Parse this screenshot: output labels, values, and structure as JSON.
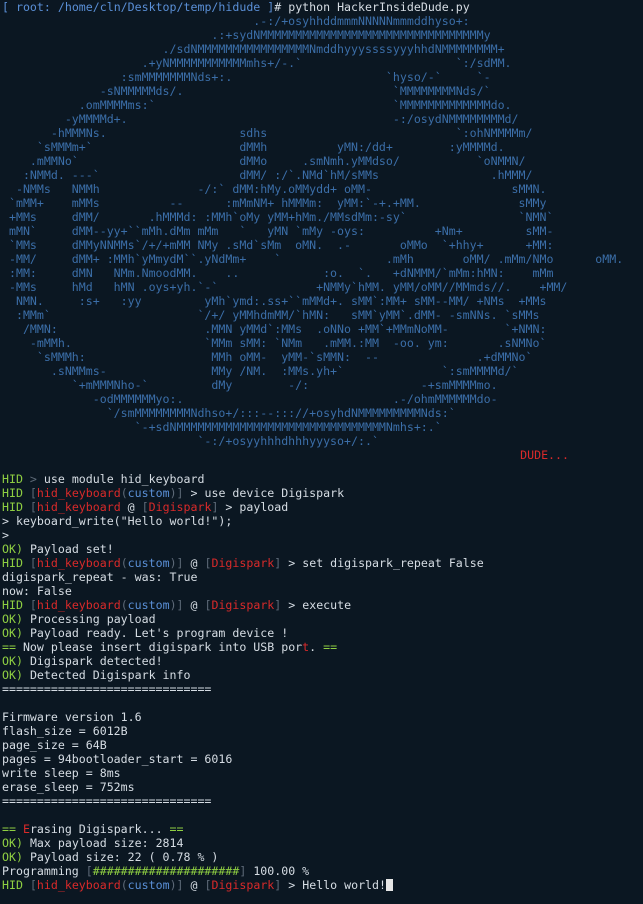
{
  "prompt": {
    "bracket_open": "[ ",
    "user": "root",
    "sep": ": ",
    "path": "/home/cln/Desktop/temp/hidude",
    "bracket_close": " ]",
    "hash": "# ",
    "command": "python HackerInsideDude.py"
  },
  "art_lines": [
    "                                    .-:/+osyhhddmmmNNNNNmmmddhyso+:",
    "                              .:+sydNMMMMMMMMMMMMMMMMMMMMMMMMMMMMMMMMy",
    "                       ./sdNMMMMMMMMMMMMMMMMNmddhyyyssssyyyhhdNMMMMMMMM+",
    "                    .+yNMMMMMMMMMMMmhs+/-.`                      `:/sdMM.",
    "                 :smMMMMMMMNds+:.                      `hyso/-`     `-",
    "              -sNMMMMMds/.                              `MMMMMMMMNds/`",
    "           .omMMMMms:`                                  `MMMMMMMMMMMMMdo.",
    "         -yMMMMd+.                                      -:/osydNMMMMMMMMd/",
    "       -hMMMNs.                   sdhs                           `:ohNMMMMm/",
    "     `sMMMm+`                     dMMh          yMN:/dd+        :yMMMMd.",
    "    .mMMNo`                       dMMo     .smNmh.yMMdso/           `oNMMN/",
    "   :NMMd. ---`                    dMM/ :/`.NMd`hM/sMMs                .hMMM/",
    "  -NMMs   NMMh              -/:` dMM:hMy.oMMydd+ oMM-                    sMMN.",
    " `mMM+    mMMs          --      :mMmNM+ hMMMm:  yMM:`-+.+MM.              sMMy",
    " +MMs     dMM/       .hMMMd: :MMh`oMy yMM+hMm./MMsdMm:-sy`                `NMN`",
    " mMN`     dMM--yy+``mMh.dMm mMm   `   yMN `mMy -oys:          +Nm+         sMM-",
    " `MMs     dMMyNNMMs`/+/+mMM NMy .sMd`sMm  oMN.  .-       oMMo  `+hhy+      +MM:",
    " -MM/     dMM+ :MMh`yMmydM``.yNdMm+    `               .mMh       oMM/ .mMm/NMo      oMM.",
    " :MM:     dMN   NMm.NmoodMM.    ..            :o.  `.   +dNMMM/`mMm:hMN:    mMm",
    " -MMs     hMd   hMN .oys+yh.`-`              +NMMy`hMM. yMM/oMM//MMmds//.    +MM/",
    "  NMN.     :s+   :yy         yMh`ymd:.ss+``mMMd+. sMM`:MM+ sMM--MM/ +NMs  +MMs",
    "  :MMm`                     `/+/ yMMhdmMM/`hMN:   sMM`yMM`.dMM- -smNNs. `sMMs",
    "   /MMN:                     .MMN yMMd`:MMs  .oNNo +MM`+MMmNoMM-        `+NMN:",
    "    -mMMh.                   `MMm sMM: `NMm   .mMM.:MM  -oo. ym:       .sNMNo`",
    "     `sMMMh:                  MMh oMM-  yMM-`sMMN:  --              .+dMMNo`",
    "       .sNMMms-               MMy /NM.  :MMs.yh+`              `:smMMMMd/`",
    "          `+mMMMNho-`         dMy        -/:                -+smMMMMmo.",
    "             -odMMMMMMyo:.                              .-/ohmMMMMMMdo-",
    "               `/smMMMMMMMMNdhso+/:::--::://+osyhdNMMMMMMMMMNds:`",
    "                   `-+sdNMMMMMMMMMMMMMMMMMMMMMMMMMMMMMMNmhs+:.`",
    "                            `-:/+osyyhhhdhhhyyyso+/:.`"
  ],
  "dude_tag": "DUDE...",
  "lines": [
    {
      "type": "hid0",
      "command": "use module hid_keyboard"
    },
    {
      "type": "hid1",
      "module": "hid_keyboard",
      "tag": "custom",
      "command": "use device Digispark"
    },
    {
      "type": "hid2",
      "module": "hid_keyboard",
      "device": "Digispark",
      "command": "payload"
    },
    {
      "type": "plain",
      "text": "> keyboard_write(\"Hello world!\");"
    },
    {
      "type": "plain",
      "text": ">"
    },
    {
      "type": "ok",
      "text": "Payload set!"
    },
    {
      "type": "hid3",
      "module": "hid_keyboard",
      "tag": "custom",
      "device": "Digispark",
      "command": "set digispark_repeat False"
    },
    {
      "type": "plain",
      "text": "digispark_repeat - was: True"
    },
    {
      "type": "plain",
      "text": "now: False"
    },
    {
      "type": "hid3",
      "module": "hid_keyboard",
      "tag": "custom",
      "device": "Digispark",
      "command": "execute"
    },
    {
      "type": "ok",
      "text": "Processing payload"
    },
    {
      "type": "ok",
      "text": "Payload ready. Let's program device !"
    },
    {
      "type": "notice",
      "before": "Now please insert digispark into USB por",
      "red": "t",
      "after": "."
    },
    {
      "type": "ok",
      "text": "Digispark detected!"
    },
    {
      "type": "ok",
      "text": "Detected Digispark info"
    },
    {
      "type": "plain",
      "text": "=============================="
    },
    {
      "type": "blank"
    },
    {
      "type": "plain",
      "text": "Firmware version 1.6"
    },
    {
      "type": "plain",
      "text": "flash_size = 6012B"
    },
    {
      "type": "plain",
      "text": "page_size = 64B"
    },
    {
      "type": "plain",
      "text": "pages = 94bootloader_start = 6016"
    },
    {
      "type": "plain",
      "text": "write sleep = 8ms"
    },
    {
      "type": "plain",
      "text": "erase_sleep = 752ms"
    },
    {
      "type": "plain",
      "text": "=============================="
    },
    {
      "type": "blank"
    },
    {
      "type": "erase",
      "red": "E",
      "text": "rasing Digispark..."
    },
    {
      "type": "ok",
      "text": "Max payload size: 2814"
    },
    {
      "type": "ok",
      "text": "Payload size: 22 ( 0.78 % )"
    },
    {
      "type": "progress",
      "label": "Programming",
      "bar": "#####################",
      "percent_text": "100.00 %",
      "progress": 1.0
    },
    {
      "type": "final",
      "module": "hid_keyboard",
      "tag": "custom",
      "device": "Digispark",
      "command": "Hello world!"
    }
  ],
  "tokens": {
    "hid": "HID",
    "ok": "OK)",
    "eq": "=="
  },
  "colors": {
    "background": "#0b1722",
    "prompt_blue": "#5a8fd6",
    "ok_green": "#8fcf42",
    "module_red": "#d92a2a",
    "art_blue": "#3b6ea8"
  }
}
